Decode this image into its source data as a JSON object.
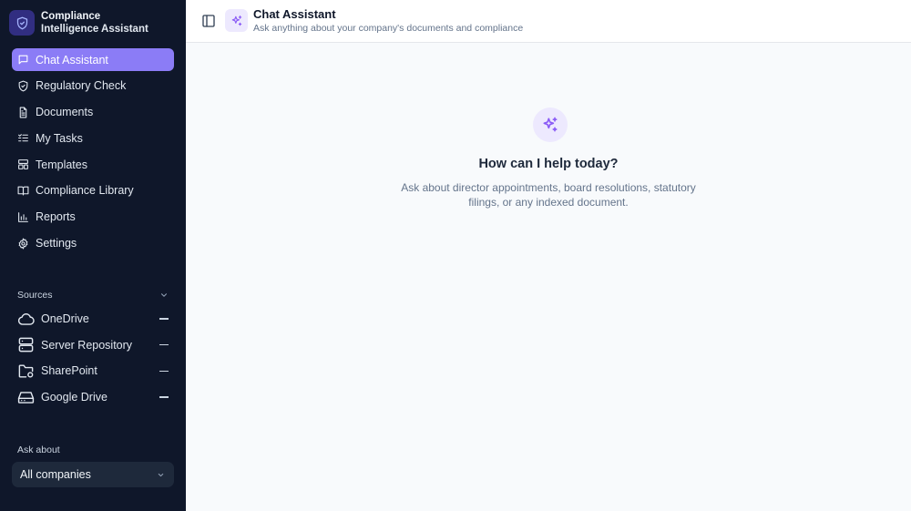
{
  "brand": {
    "line1": "Compliance",
    "line2": "Intelligence Assistant"
  },
  "nav": {
    "items": [
      {
        "label": "Chat Assistant",
        "icon": "chat-icon",
        "active": true
      },
      {
        "label": "Regulatory Check",
        "icon": "shield-check-icon"
      },
      {
        "label": "Documents",
        "icon": "document-icon"
      },
      {
        "label": "My Tasks",
        "icon": "tasks-icon"
      },
      {
        "label": "Templates",
        "icon": "template-icon"
      },
      {
        "label": "Compliance Library",
        "icon": "book-icon"
      },
      {
        "label": "Reports",
        "icon": "bar-chart-icon"
      },
      {
        "label": "Settings",
        "icon": "gear-icon"
      }
    ]
  },
  "sources": {
    "label": "Sources",
    "items": [
      {
        "label": "OneDrive",
        "icon": "cloud-icon"
      },
      {
        "label": "Server Repository",
        "icon": "server-icon"
      },
      {
        "label": "SharePoint",
        "icon": "folder-share-icon"
      },
      {
        "label": "Google Drive",
        "icon": "drive-icon"
      }
    ]
  },
  "ask": {
    "label": "Ask about",
    "selected": "All companies"
  },
  "header": {
    "title": "Chat Assistant",
    "subtitle": "Ask anything about your company's documents and compliance"
  },
  "empty": {
    "title": "How can I help today?",
    "description": "Ask about director appointments, board resolutions, statutory filings, or any indexed document."
  },
  "colors": {
    "sidebar_bg": "#0f172a",
    "accent": "#8b7cf6",
    "accent_light": "#ede9fe",
    "main_bg": "#f8fafc"
  }
}
